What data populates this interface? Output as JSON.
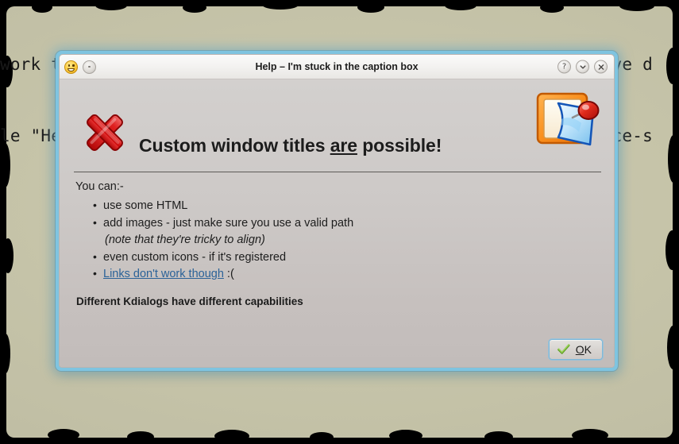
{
  "backdrop": {
    "terminal_lines": [
      "work though</a> <b>:(</b></li></ul><h4>Different Kdialogs have d",
      "le \"Help\" --caption \"I'm stuck in the caption box\" --icon face-s"
    ],
    "paper_color": "#c6c4a9"
  },
  "dialog": {
    "titlebar": {
      "app_icon": "face-smile-icon",
      "menu_button": "window-menu-button",
      "title": "Help – I'm stuck in the caption box",
      "help_button": "?",
      "shade_button": "⌄",
      "close_button": "×"
    },
    "header": {
      "error_icon": "dialog-error-icon",
      "heading_before": "Custom window titles ",
      "heading_underlined": "are",
      "heading_after": " possible!",
      "side_icon": "knotes-pin-note-icon"
    },
    "content": {
      "intro": "You can:-",
      "items": [
        {
          "text": "use some HTML",
          "style": "bullet"
        },
        {
          "text": "add images - just make sure you use a valid path",
          "style": "bullet"
        },
        {
          "text": "(note that they're tricky to align)",
          "style": "italic-continuation"
        },
        {
          "text": "even custom icons - if it's registered",
          "style": "bullet"
        },
        {
          "text": "Links don't work though",
          "style": "bullet-link",
          "suffix": " :("
        }
      ],
      "footnote": "Different Kdialogs have different capabilities"
    },
    "buttons": {
      "ok_accel": "O",
      "ok_rest": "K",
      "ok_icon": "green-check-icon"
    },
    "colors": {
      "border_glow": "#7fc4e0",
      "body_top": "#d3d0ce",
      "body_bottom": "#c2bcba",
      "titlebar": "#f2f1ef",
      "link": "#2b6298",
      "error_red": "#cf1010",
      "check_green": "#7ec13c",
      "accent_focus": "#7fb8d8"
    }
  }
}
